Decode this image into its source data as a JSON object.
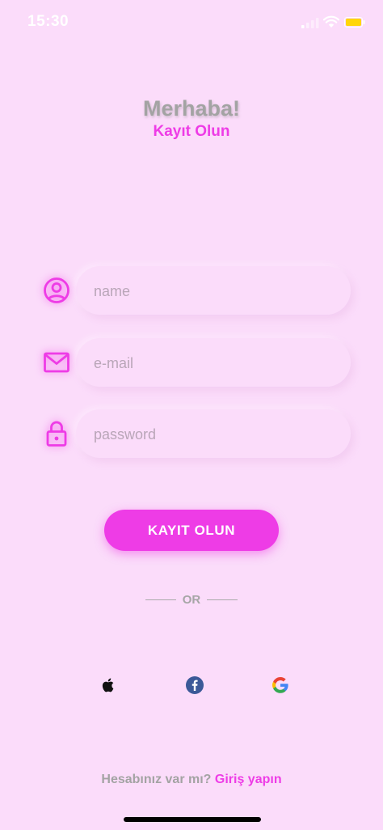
{
  "status_bar": {
    "time": "15:30",
    "signal_icon": "cellular-signal-icon",
    "wifi_icon": "wifi-icon",
    "battery_icon": "battery-icon",
    "battery_color": "#ffd60a"
  },
  "header": {
    "title": "Merhaba!",
    "subtitle": "Kayıt Olun"
  },
  "form": {
    "name": {
      "icon": "user-circle-icon",
      "placeholder": "name",
      "value": ""
    },
    "email": {
      "icon": "mail-icon",
      "placeholder": "e-mail",
      "value": ""
    },
    "password": {
      "icon": "lock-icon",
      "placeholder": "password",
      "value": ""
    },
    "submit_label": "KAYIT OLUN"
  },
  "divider": {
    "label": "OR"
  },
  "social": {
    "apple_icon": "apple-icon",
    "facebook_icon": "facebook-icon",
    "google_icon": "google-icon"
  },
  "footer": {
    "prompt": "Hesabınız var mı?",
    "link": "Giriş yapın"
  },
  "colors": {
    "background": "#fbdcfa",
    "accent": "#ee3ce6",
    "muted_text": "#a3a3a3",
    "facebook": "#3b5998"
  }
}
